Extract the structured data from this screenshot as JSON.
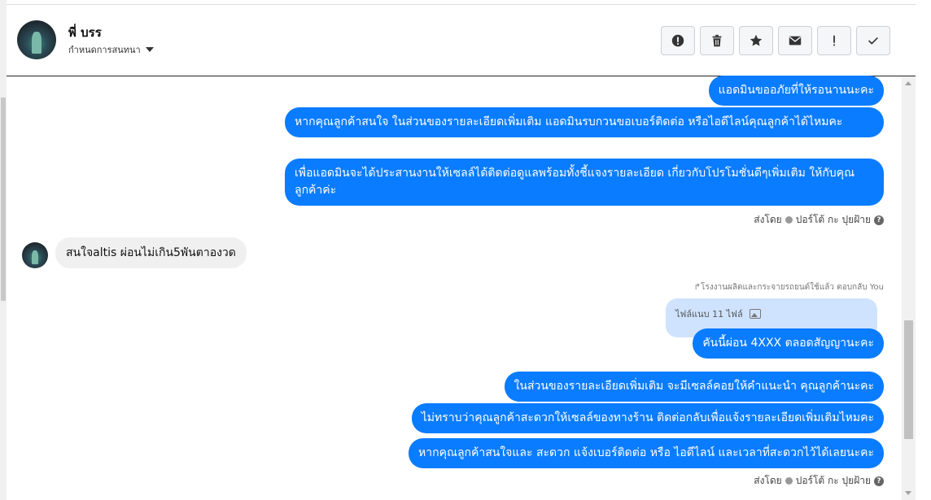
{
  "header": {
    "name": "พี่ บรร",
    "conversation_settings": "กำหนดการสนทนา"
  },
  "toolbar": {
    "buttons": [
      "exclamation-circle-icon",
      "trash-icon",
      "star-icon",
      "envelope-icon",
      "exclamation-icon",
      "check-icon"
    ]
  },
  "messages": {
    "out1": "แอดมินขออภัยที่ให้รอนานนะคะ",
    "out2": "หากคุณลูกค้าสนใจ ในส่วนของรายละเอียดเพิ่มเติม แอดมินรบกวนขอเบอร์ติดต่อ หรือไอดีไลน์คุณลูกค้าได้ไหมคะ",
    "out3": "เพื่อแอดมินจะได้ประสานงานให้เซลล์ได้ติดต่อดูแลพร้อมทั้งชี้แจงรายละเอียด เกี่ยวกับโปรโมชั่นดีๆเพิ่มเติม ให้กับคุณลูกค้าค่ะ",
    "sent_by_1": "ส่งโดย",
    "sender_1": "ปอร์โต้ กะ ปุยฝ้าย",
    "incoming1": "สนใจaltis ผ่อนไม่เกิน5พันตาองวด",
    "replied_note": "โรงงานผลิตและกระจายรถยนต์ใช้แล้ว ตอบกลับ You",
    "attachment": "ไฟล์แนบ 11 ไฟล์",
    "out4": "คันนี้ผ่อน 4XXX ตลอดสัญญานะคะ",
    "out5": "ในส่วนของรายละเอียดเพิ่มเติม จะมีเซลล์คอยให้คำแนะนำ คุณลูกค้านะคะ",
    "out6": "ไม่ทราบว่าคุณลูกค้าสะดวกให้เซลล์ของทางร้าน ติดต่อกลับเพื่อแจ้งรายละเอียดเพิ่มเติมไหมคะ",
    "out7": "หากคุณลูกค้าสนใจและ สะดวก แจ้งเบอร์ติดต่อ หรือ ไอดีไลน์ และเวลาที่สะดวกไว้ได้เลยนะคะ",
    "sent_by_2": "ส่งโดย",
    "sender_2": "ปอร์โต้ กะ ปุยฝ้าย"
  },
  "colors": {
    "outgoing": "#0a7cff",
    "incoming": "#f0f0f0"
  }
}
